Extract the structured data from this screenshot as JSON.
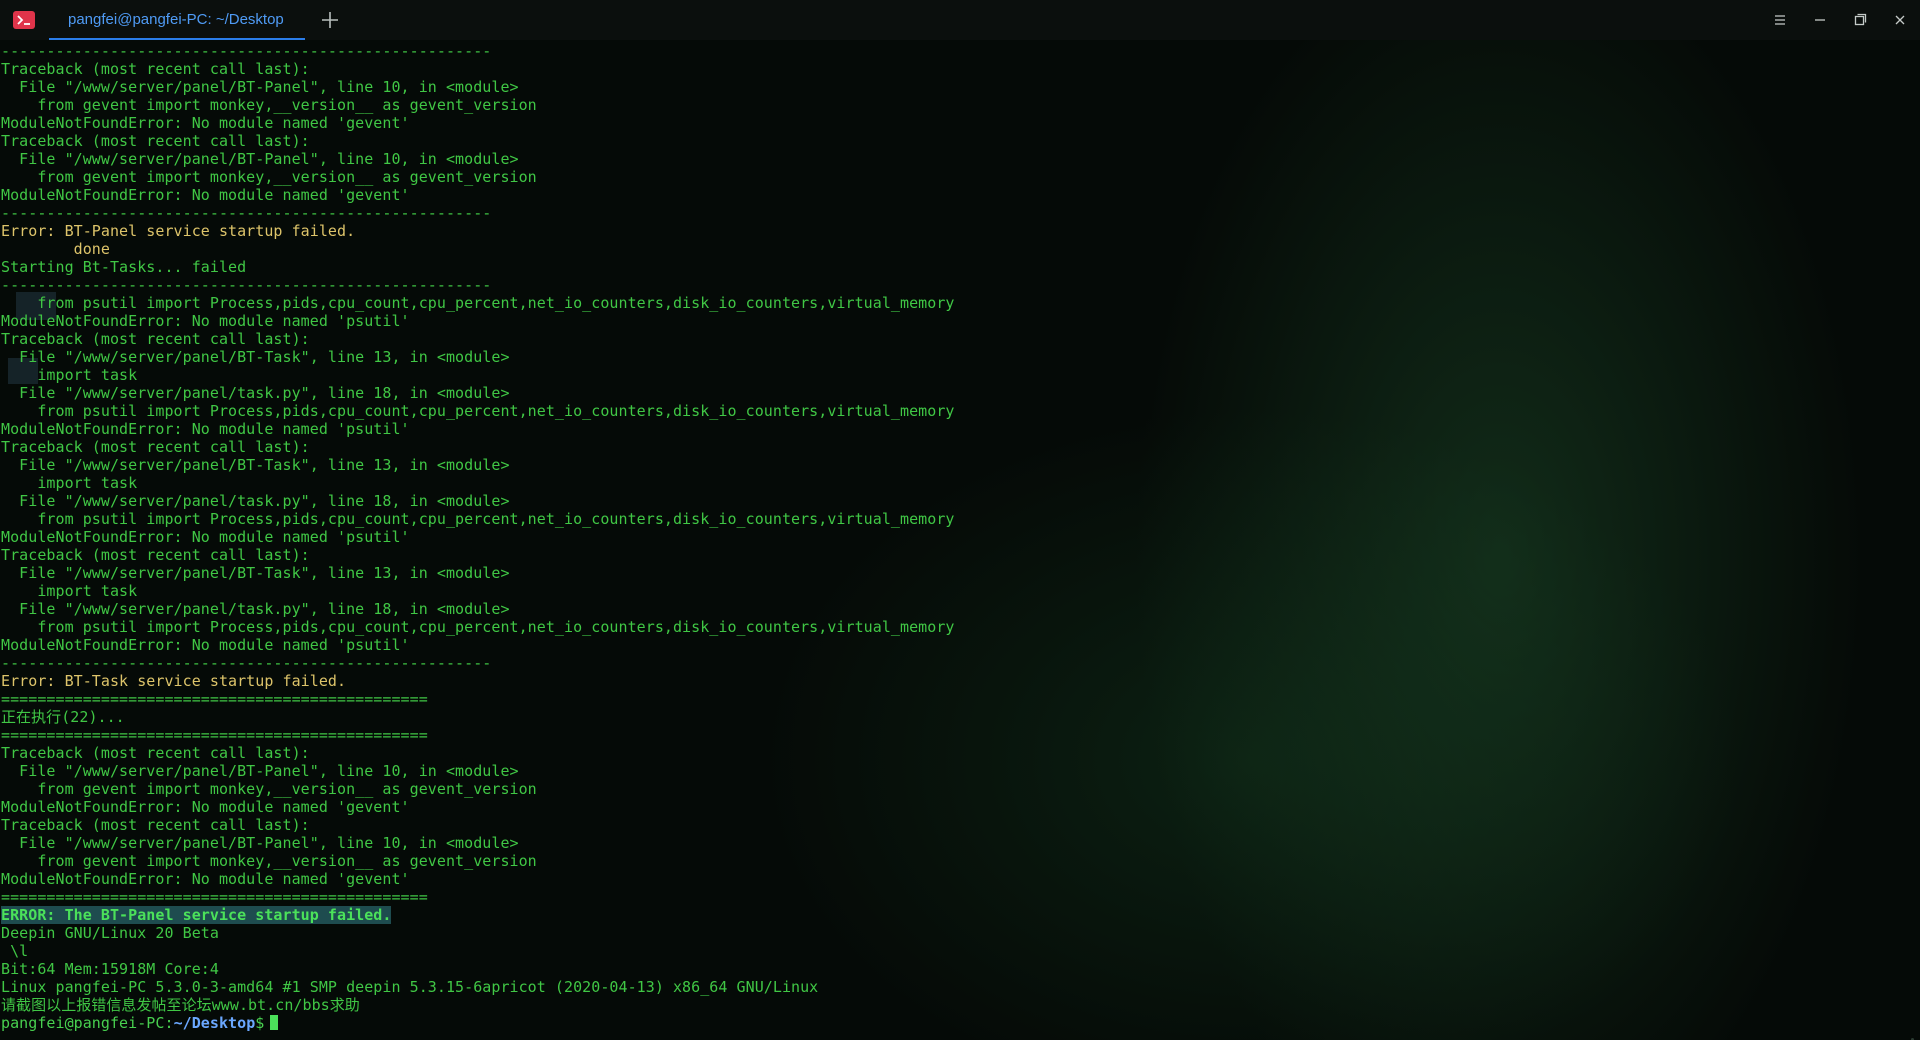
{
  "titlebar": {
    "tab_title": "pangfei@pangfei-PC: ~/Desktop"
  },
  "terminal": {
    "lines": [
      "------------------------------------------------------",
      "Traceback (most recent call last):",
      "  File \"/www/server/panel/BT-Panel\", line 10, in <module>",
      "    from gevent import monkey,__version__ as gevent_version",
      "ModuleNotFoundError: No module named 'gevent'",
      "Traceback (most recent call last):",
      "  File \"/www/server/panel/BT-Panel\", line 10, in <module>",
      "    from gevent import monkey,__version__ as gevent_version",
      "ModuleNotFoundError: No module named 'gevent'",
      "------------------------------------------------------",
      "Error: BT-Panel service startup failed.",
      "        done",
      "Starting Bt-Tasks... failed",
      "------------------------------------------------------",
      "    from psutil import Process,pids,cpu_count,cpu_percent,net_io_counters,disk_io_counters,virtual_memory",
      "ModuleNotFoundError: No module named 'psutil'",
      "Traceback (most recent call last):",
      "  File \"/www/server/panel/BT-Task\", line 13, in <module>",
      "    import task",
      "  File \"/www/server/panel/task.py\", line 18, in <module>",
      "    from psutil import Process,pids,cpu_count,cpu_percent,net_io_counters,disk_io_counters,virtual_memory",
      "ModuleNotFoundError: No module named 'psutil'",
      "Traceback (most recent call last):",
      "  File \"/www/server/panel/BT-Task\", line 13, in <module>",
      "    import task",
      "  File \"/www/server/panel/task.py\", line 18, in <module>",
      "    from psutil import Process,pids,cpu_count,cpu_percent,net_io_counters,disk_io_counters,virtual_memory",
      "ModuleNotFoundError: No module named 'psutil'",
      "Traceback (most recent call last):",
      "  File \"/www/server/panel/BT-Task\", line 13, in <module>",
      "    import task",
      "  File \"/www/server/panel/task.py\", line 18, in <module>",
      "    from psutil import Process,pids,cpu_count,cpu_percent,net_io_counters,disk_io_counters,virtual_memory",
      "ModuleNotFoundError: No module named 'psutil'",
      "------------------------------------------------------",
      "Error: BT-Task service startup failed.",
      "===============================================",
      "正在执行(22)...",
      "===============================================",
      "Traceback (most recent call last):",
      "  File \"/www/server/panel/BT-Panel\", line 10, in <module>",
      "    from gevent import monkey,__version__ as gevent_version",
      "ModuleNotFoundError: No module named 'gevent'",
      "Traceback (most recent call last):",
      "  File \"/www/server/panel/BT-Panel\", line 10, in <module>",
      "    from gevent import monkey,__version__ as gevent_version",
      "ModuleNotFoundError: No module named 'gevent'",
      "===============================================",
      "ERROR: The BT-Panel service startup failed.",
      "Deepin GNU/Linux 20 Beta",
      " \\l",
      "Bit:64 Mem:15918M Core:4",
      "Linux pangfei-PC 5.3.0-3-amd64 #1 SMP deepin 5.3.15-6apricot (2020-04-13) x86_64 GNU/Linux",
      "请截图以上报错信息发帖至论坛www.bt.cn/bbs求助"
    ],
    "prompt_user": "pangfei@pangfei-PC",
    "prompt_sep": ":",
    "prompt_path": "~/Desktop",
    "prompt_symbol": "$"
  },
  "icons": {
    "app": "terminal-icon",
    "new_tab": "plus-icon",
    "menu": "menu-icon",
    "minimize": "minimize-icon",
    "maximize": "maximize-icon",
    "close": "close-icon"
  },
  "colors": {
    "accent": "#2b7de9",
    "text_green": "#40c745",
    "text_yellow": "#ddc46a",
    "highlight_bg": "#1e4c4f"
  }
}
